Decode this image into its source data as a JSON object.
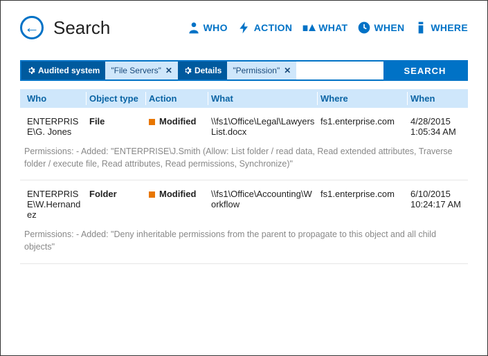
{
  "header": {
    "title": "Search",
    "facets": {
      "who": "WHO",
      "action": "ACTION",
      "what": "WHAT",
      "when": "WHEN",
      "where": "WHERE"
    }
  },
  "filter": {
    "pill1_label": "Audited system",
    "pill1_value": "\"File Servers\"",
    "pill2_label": "Details",
    "pill2_value": "\"Permission\"",
    "close": "✕",
    "search_button": "SEARCH"
  },
  "columns": {
    "who": "Who",
    "type": "Object type",
    "action": "Action",
    "what": "What",
    "where": "Where",
    "when": "When"
  },
  "rows": [
    {
      "who": "ENTERPRISE\\G. Jones",
      "type": "File",
      "action": "Modified",
      "what": "\\\\fs1\\Office\\Legal\\LawyersList.docx",
      "where": "fs1.enterprise.com",
      "when_date": "4/28/2015",
      "when_time": "1:05:34 AM",
      "detail": "Permissions: - Added: \"ENTERPRISE\\J.Smith (Allow: List folder / read data, Read extended attributes, Traverse folder / execute file, Read attributes, Read permissions, Synchronize)\""
    },
    {
      "who": "ENTERPRISE\\W.Hernandez",
      "type": "Folder",
      "action": "Modified",
      "what": "\\\\fs1\\Office\\Accounting\\Workflow",
      "where": "fs1.enterprise.com",
      "when_date": "6/10/2015",
      "when_time": "10:24:17 AM",
      "detail": "Permissions: - Added: \"Deny inheritable permissions from the parent to propagate to this object and all child objects\""
    }
  ]
}
